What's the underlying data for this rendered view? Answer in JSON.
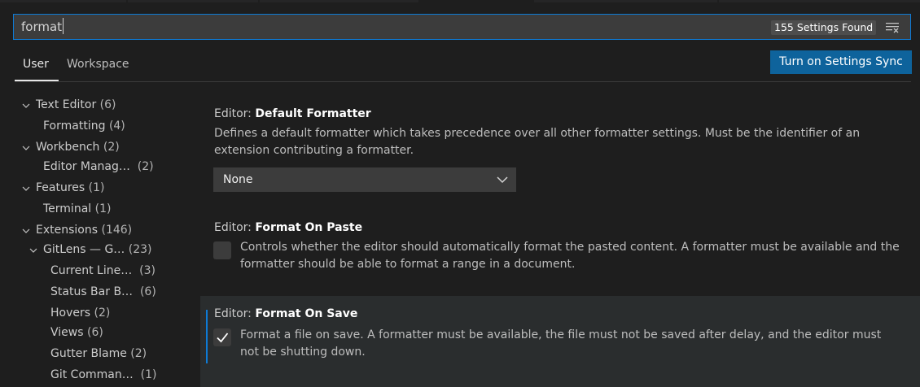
{
  "search": {
    "value": "format",
    "results_count": "155 Settings Found",
    "clear_icon": "clear-filter-icon"
  },
  "tabs": [
    {
      "label": "User",
      "active": true
    },
    {
      "label": "Workspace",
      "active": false
    }
  ],
  "sync_button_label": "Turn on Settings Sync",
  "toc": [
    {
      "label": "Text Editor",
      "count": "(6)",
      "level": 0,
      "expanded": true
    },
    {
      "label": "Formatting",
      "count": "(4)",
      "level": 1
    },
    {
      "label": "Workbench",
      "count": "(2)",
      "level": 0,
      "expanded": true
    },
    {
      "label": "Editor Manag…",
      "count": "(2)",
      "level": 1
    },
    {
      "label": "Features",
      "count": "(1)",
      "level": 0,
      "expanded": true
    },
    {
      "label": "Terminal",
      "count": "(1)",
      "level": 1
    },
    {
      "label": "Extensions",
      "count": "(146)",
      "level": 0,
      "expanded": true
    },
    {
      "label": "GitLens — G…",
      "count": "(23)",
      "level": 1,
      "expanded": true
    },
    {
      "label": "Current Line…",
      "count": "(3)",
      "level": 2
    },
    {
      "label": "Status Bar B…",
      "count": "(6)",
      "level": 2
    },
    {
      "label": "Hovers",
      "count": "(2)",
      "level": 2
    },
    {
      "label": "Views",
      "count": "(6)",
      "level": 2
    },
    {
      "label": "Gutter Blame",
      "count": "(2)",
      "level": 2
    },
    {
      "label": "Git Comman…",
      "count": "(1)",
      "level": 2
    }
  ],
  "settings": {
    "default_formatter": {
      "category": "Editor: ",
      "name": "Default Formatter",
      "description": "Defines a default formatter which takes precedence over all other formatter settings. Must be the identifier of an extension contributing a formatter.",
      "value": "None"
    },
    "format_on_paste": {
      "category": "Editor: ",
      "name": "Format On Paste",
      "description": "Controls whether the editor should automatically format the pasted content. A formatter must be available and the formatter should be able to format a range in a document.",
      "checked": false
    },
    "format_on_save": {
      "category": "Editor: ",
      "name": "Format On Save",
      "description": "Format a file on save. A formatter must be available, the file must not be saved after delay, and the editor must not be shutting down.",
      "checked": true
    }
  },
  "colors": {
    "background": "#1e1e1e",
    "accent": "#0e7bd6",
    "button": "#0e639c",
    "input": "#3c3c3c",
    "focused_row": "#2a2d2e"
  }
}
